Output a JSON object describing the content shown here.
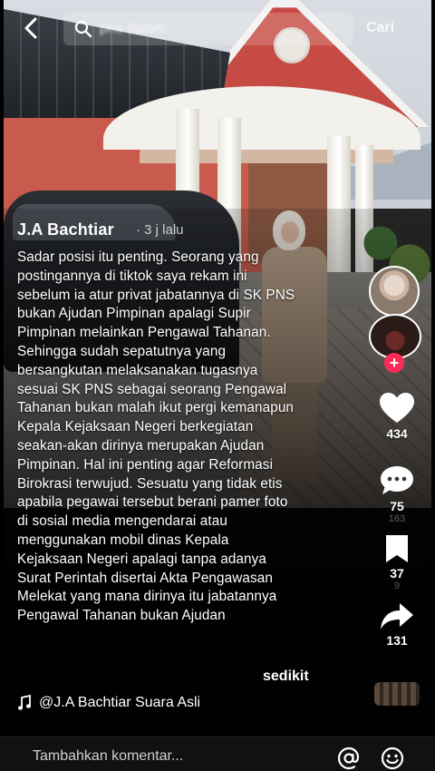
{
  "search": {
    "query": "pns dalam",
    "submit_label": "Cari"
  },
  "post": {
    "author": "J.A Bachtiar",
    "time": "· 3 j lalu",
    "caption": "Sadar posisi itu penting. Seorang yang postingannya di tiktok saya rekam ini sebelum ia atur privat jabatannya di SK PNS bukan Ajudan Pimpinan apalagi Supir Pimpinan melainkan Pengawal Tahanan. Sehingga sudah sepatutnya yang bersangkutan melaksanakan tugasnya sesuai SK PNS sebagai seorang Pengawal Tahanan bukan malah ikut pergi kemanapun Kepala Kejaksaan Negeri berkegiatan seakan-akan dirinya merupakan Ajudan Pimpinan. Hal ini penting agar Reformasi Birokrasi terwujud. Sesuatu yang tidak etis apabila pegawai tersebut berani pamer foto di sosial media mengendarai atau menggunakan mobil dinas Kepala Kejaksaan Negeri apalagi tanpa adanya Surat Perintah disertai Akta Pengawasan Melekat yang mana dirinya itu jabatannya Pengawal Tahanan bukan Ajudan",
    "more_label": "sedikit",
    "sound": "@J.A Bachtiar Suara Asli"
  },
  "actions": {
    "likes": "434",
    "comments": "75",
    "comments_ghost": "163",
    "saves": "37",
    "saves_ghost": "9",
    "shares": "131"
  },
  "comment_bar": {
    "placeholder": "Tambahkan komentar..."
  },
  "icons": {
    "back": "chevron-left-icon",
    "search": "search-icon",
    "like": "heart-icon",
    "comment": "comment-bubble-icon",
    "save": "bookmark-icon",
    "share": "share-arrow-icon",
    "music": "music-note-icon",
    "mention": "at-sign-icon",
    "emoji": "smiley-icon"
  },
  "colors": {
    "follow_accent": "#fe2c55"
  }
}
